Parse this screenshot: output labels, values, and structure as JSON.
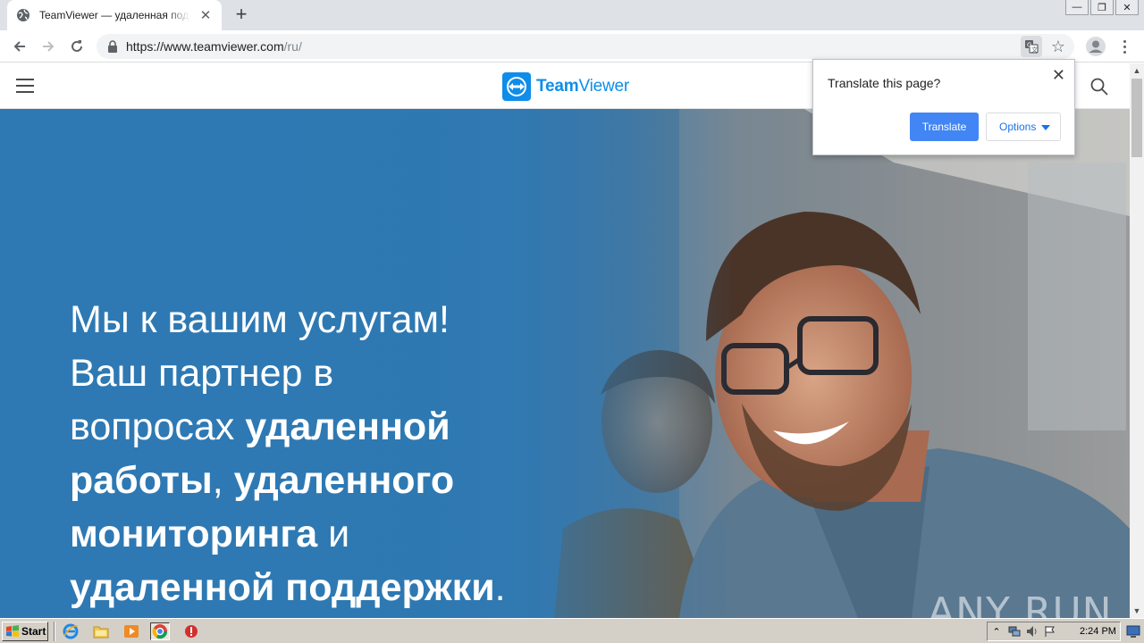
{
  "browser": {
    "tab_title": "TeamViewer — удаленная поддерж",
    "tab_close_label": "✕",
    "new_tab_label": "+",
    "url_host": "https://www.teamviewer.com",
    "url_path": "/ru/"
  },
  "window_controls": {
    "minimize": "—",
    "restore": "❐",
    "close": "✕"
  },
  "site": {
    "logo_bold": "Team",
    "logo_regular": "Viewer"
  },
  "hero": {
    "line1": "Мы к вашим услугам!",
    "line2": "Ваш партнер в",
    "line3_regular": "вопросах ",
    "line3_bold": "удаленной",
    "line4_bold": "работы",
    "line4_regular": ", ",
    "line4_bold2": "удаленного",
    "line5_bold": "мониторинга",
    "line5_regular": " и",
    "line6_bold": "удаленной поддержки",
    "line6_regular": "."
  },
  "translate_popup": {
    "title": "Translate this page?",
    "close": "✕",
    "translate_button": "Translate",
    "options_button": "Options"
  },
  "watermark": "ANY RUN",
  "taskbar": {
    "start_label": "Start",
    "clock": "2:24 PM"
  },
  "colors": {
    "brand_blue": "#0e8ee9",
    "translate_button": "#4285f4",
    "hero_blue": "#2e79b3"
  }
}
